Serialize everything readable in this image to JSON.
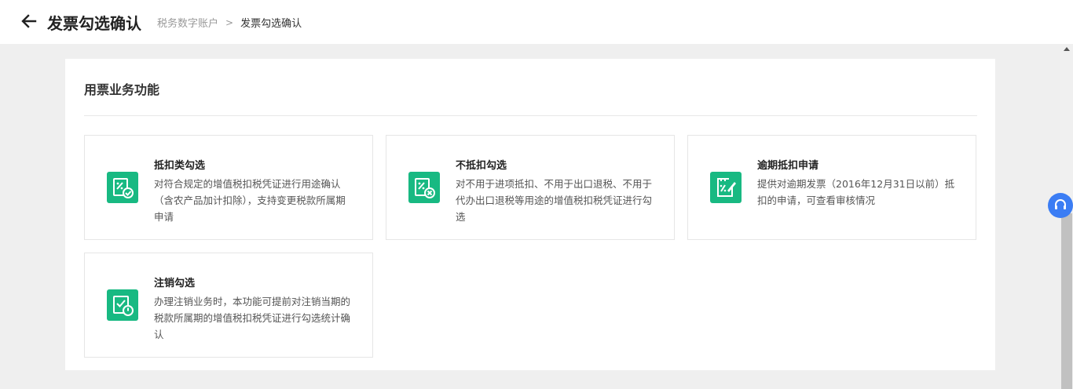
{
  "header": {
    "back_icon": "arrow-left-icon",
    "title": "发票勾选确认",
    "breadcrumb": {
      "parent": "税务数字账户",
      "separator": ">",
      "current": "发票勾选确认"
    }
  },
  "section": {
    "title": "用票业务功能"
  },
  "cards": [
    {
      "name": "抵扣类勾选",
      "description": "对符合规定的增值税扣税凭证进行用途确认（含农产品加计扣除），支持变更税款所属期申请",
      "icon": "deduction-check-icon"
    },
    {
      "name": "不抵扣勾选",
      "description": "对不用于进项抵扣、不用于出口退税、不用于代办出口退税等用途的增值税扣税凭证进行勾选",
      "icon": "non-deduction-icon"
    },
    {
      "name": "逾期抵扣申请",
      "description": "提供对逾期发票（2016年12月31日以前）抵扣的申请，可查看审核情况",
      "icon": "overdue-application-icon"
    },
    {
      "name": "注销勾选",
      "description": "办理注销业务时，本功能可提前对注销当期的税款所属期的增值税扣税凭证进行勾选统计确认",
      "icon": "cancellation-check-icon"
    }
  ],
  "floating": {
    "support_icon": "headset-icon"
  },
  "colors": {
    "accent_green": "#18b982",
    "support_blue": "#3b7df4"
  }
}
